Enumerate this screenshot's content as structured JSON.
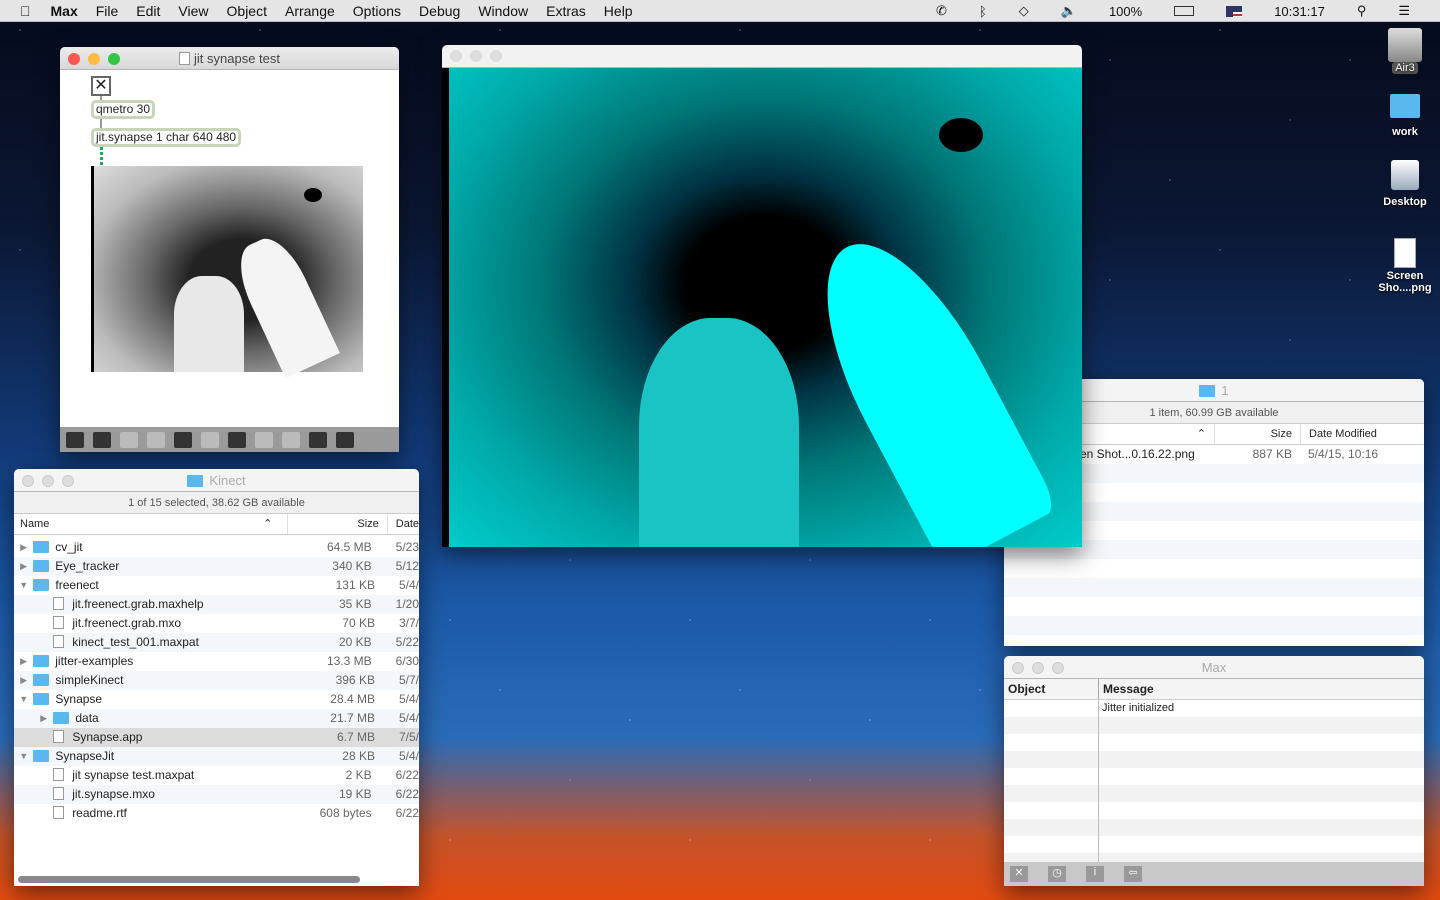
{
  "menubar": {
    "items": [
      "Max",
      "File",
      "Edit",
      "View",
      "Object",
      "Arrange",
      "Options",
      "Debug",
      "Window",
      "Extras",
      "Help"
    ],
    "battery": "100%",
    "clock": "10:31:17"
  },
  "patcher": {
    "title": "jit synapse test",
    "objects": [
      "qmetro 30",
      "jit.synapse 1 char 640 480"
    ]
  },
  "kinect": {
    "title": "Kinect",
    "status": "1 of 15 selected, 38.62 GB available",
    "headers": {
      "name": "Name",
      "size": "Size",
      "date": "Date"
    },
    "rows": [
      {
        "name": "cv_jit",
        "size": "64.5 MB",
        "date": "5/23",
        "t": "folder",
        "d": 0,
        "tri": "▶"
      },
      {
        "name": "Eye_tracker",
        "size": "340 KB",
        "date": "5/12",
        "t": "folder",
        "d": 0,
        "tri": "▶"
      },
      {
        "name": "freenect",
        "size": "131 KB",
        "date": "5/4/",
        "t": "folder",
        "d": 0,
        "tri": "▼"
      },
      {
        "name": "jit.freenect.grab.maxhelp",
        "size": "35 KB",
        "date": "1/20",
        "t": "file",
        "d": 1,
        "tri": ""
      },
      {
        "name": "jit.freenect.grab.mxo",
        "size": "70 KB",
        "date": "3/7/",
        "t": "file",
        "d": 1,
        "tri": ""
      },
      {
        "name": "kinect_test_001.maxpat",
        "size": "20 KB",
        "date": "5/22",
        "t": "file",
        "d": 1,
        "tri": ""
      },
      {
        "name": "jitter-examples",
        "size": "13.3 MB",
        "date": "6/30",
        "t": "folder",
        "d": 0,
        "tri": "▶"
      },
      {
        "name": "simpleKinect",
        "size": "396 KB",
        "date": "5/7/",
        "t": "folder",
        "d": 0,
        "tri": "▶"
      },
      {
        "name": "Synapse",
        "size": "28.4 MB",
        "date": "5/4/",
        "t": "folder",
        "d": 0,
        "tri": "▼"
      },
      {
        "name": "data",
        "size": "21.7 MB",
        "date": "5/4/",
        "t": "folder",
        "d": 1,
        "tri": "▶"
      },
      {
        "name": "Synapse.app",
        "size": "6.7 MB",
        "date": "7/5/",
        "t": "file",
        "d": 1,
        "tri": "",
        "sel": true
      },
      {
        "name": "SynapseJit",
        "size": "28 KB",
        "date": "5/4/",
        "t": "folder",
        "d": 0,
        "tri": "▼"
      },
      {
        "name": "jit synapse test.maxpat",
        "size": "2 KB",
        "date": "6/22",
        "t": "file",
        "d": 1,
        "tri": ""
      },
      {
        "name": "jit.synapse.mxo",
        "size": "19 KB",
        "date": "6/22",
        "t": "file",
        "d": 1,
        "tri": ""
      },
      {
        "name": "readme.rtf",
        "size": "608 bytes",
        "date": "6/22",
        "t": "file",
        "d": 1,
        "tri": ""
      }
    ]
  },
  "finder1": {
    "title": "1",
    "status": "1 item, 60.99 GB available",
    "headers": {
      "size": "Size",
      "date": "Date Modified"
    },
    "row": {
      "name": "en Shot...0.16.22.png",
      "size": "887 KB",
      "date": "5/4/15, 10:16"
    }
  },
  "maxwin": {
    "title": "Max",
    "headers": {
      "object": "Object",
      "message": "Message"
    },
    "message": "Jitter initialized"
  },
  "desktop": [
    "Air3",
    "work",
    "Desktop",
    "Screen Sho....png"
  ]
}
